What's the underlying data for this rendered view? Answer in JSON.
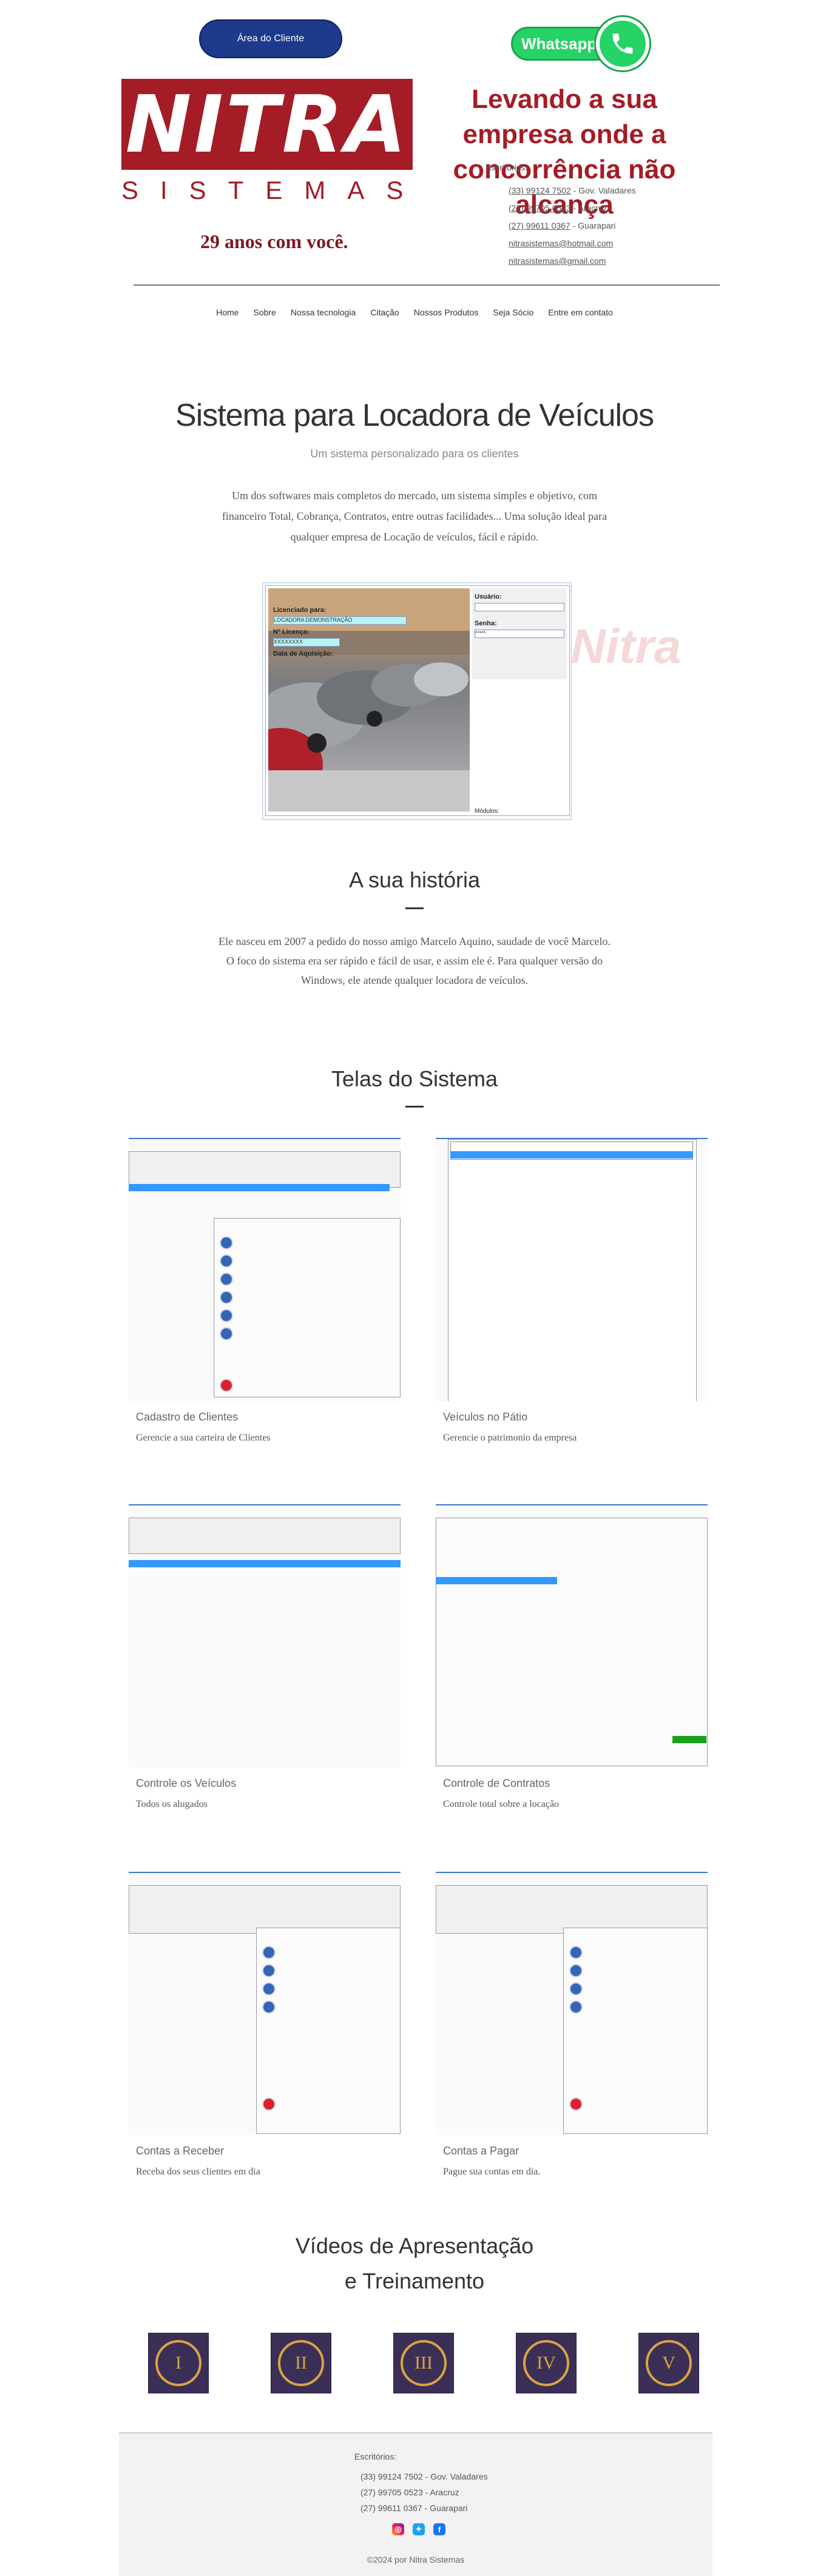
{
  "header": {
    "area_cliente": "Área do Cliente",
    "whatsapp": "Whatsapp",
    "logo_main": "NITRA",
    "logo_sub": "SISTEMAS",
    "tagline": "Levando a sua empresa onde a concorrência não alcança",
    "years": "29 anos com você.",
    "contacts_title": "Escritórios:",
    "contacts": [
      {
        "phone": "(33) 99124 7502",
        "city": " - Gov. Valadares"
      },
      {
        "phone": "(27) 99705 0523",
        "city": " - Aracruz"
      },
      {
        "phone": "(27) 99611 0367",
        "city": " - Guarapari"
      }
    ],
    "emails": [
      "nitrasistemas@hotmail.com",
      "nitrasistemas@gmail.com"
    ]
  },
  "nav": [
    "Home",
    "Sobre",
    "Nossa tecnologia",
    "Citação",
    "Nossos Produtos",
    "Seja Sócio",
    "Entre em contato"
  ],
  "hero": {
    "title": "Sistema para Locadora de Veículos",
    "subtitle": "Um sistema personalizado para os clientes",
    "text": "Um dos softwares mais completos do mercado, um sistema simples e objetivo, com financeiro Total, Cobrança, Contratos, entre outras facilidades... Uma solução ideal para qualquer empresa de Locação de veículos, fácil e rápido."
  },
  "screenshot": {
    "licensed_label": "Licenciado para:",
    "licensed_value": "LOCADORA DEMONSTRAÇÃO",
    "license_label": "Nº Licença:",
    "license_value": "XXXXXXXX",
    "acq_label": "Data de Aquisição:",
    "user_label": "Usuário:",
    "pass_label": "Senha:",
    "pass_value": "*****",
    "modules_label": "Módulos:",
    "watermark": "Nitra"
  },
  "history": {
    "title": "A sua história",
    "text": "Ele nasceu em 2007 a pedido do nosso amigo Marcelo Aquino, saudade de você Marcelo. O foco do sistema era ser rápido e fácil de usar, e assim ele é. Para qualquer versão do Windows, ele atende qualquer locadora de veículos."
  },
  "screens": {
    "title": "Telas do Sistema",
    "cards": [
      {
        "title": "Cadastro de Clientes",
        "desc": "Gerencie a sua carteira de Clientes"
      },
      {
        "title": "Veículos no Pátio",
        "desc": "Gerencie o patrimonio da empresa"
      },
      {
        "title": "Controle os Veículos",
        "desc": "Todos os alugados"
      },
      {
        "title": "Controle de Contratos",
        "desc": "Controle total sobre a locação"
      },
      {
        "title": "Contas a Receber",
        "desc": "Receba dos seus clientes em dia"
      },
      {
        "title": "Contas a Pagar",
        "desc": "Pague sua contas em dia."
      }
    ]
  },
  "videos": {
    "title_line1": "Vídeos de Apresentação",
    "title_line2": "e Treinamento",
    "items": [
      "I",
      "II",
      "III",
      "IV",
      "V"
    ]
  },
  "footer": {
    "contacts_title": "Escritórios:",
    "contacts": [
      "(33) 99124 7502 - Gov. Valadares",
      "(27) 99705 0523 - Aracruz",
      "(27) 99611 0367 - Guarapari"
    ],
    "copyright": "©2024 por Nitra Sistemas",
    "social": [
      "instagram-icon",
      "twitter-icon",
      "facebook-icon"
    ]
  }
}
